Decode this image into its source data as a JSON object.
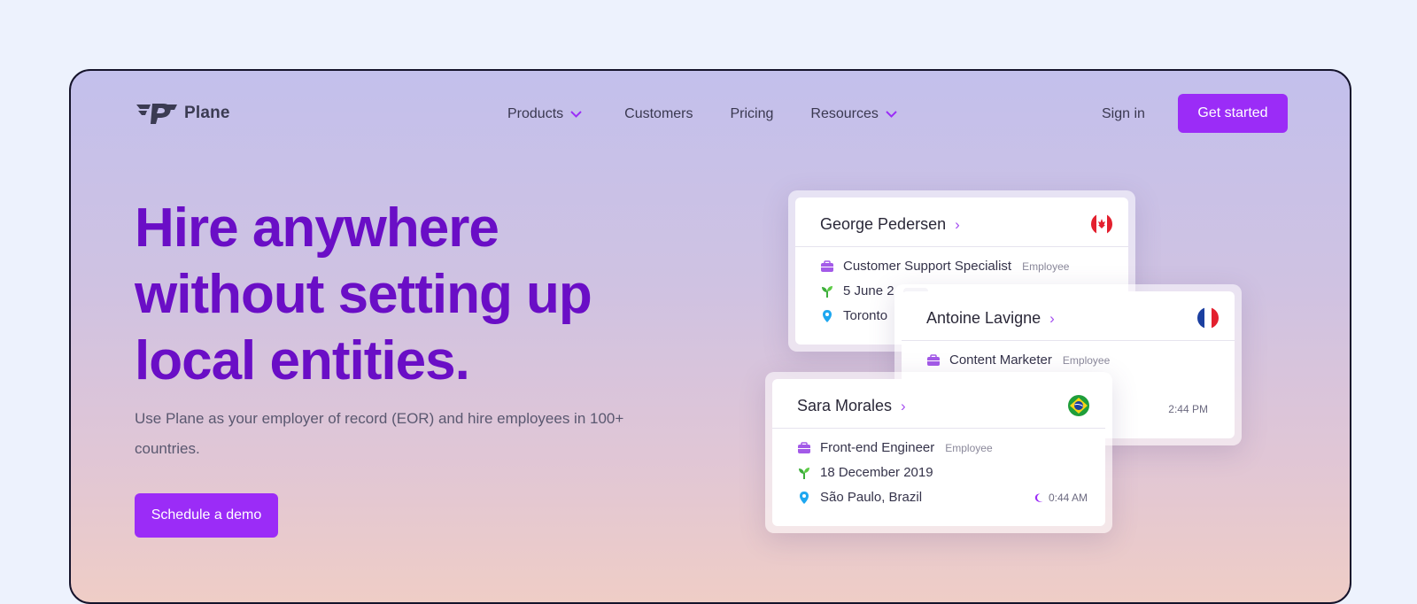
{
  "nav": {
    "logo_text": "Plane",
    "links": [
      {
        "label": "Products",
        "has_dropdown": true,
        "icon": "chevron-down-icon"
      },
      {
        "label": "Customers",
        "has_dropdown": false
      },
      {
        "label": "Pricing",
        "has_dropdown": false
      },
      {
        "label": "Resources",
        "has_dropdown": true,
        "icon": "chevron-down-icon"
      }
    ],
    "sign_in": "Sign in",
    "get_started": "Get started"
  },
  "hero": {
    "title": "Hire anywhere without setting up local entities.",
    "subtitle": "Use Plane as your employer of record (EOR) and hire employees in 100+ countries.",
    "cta": "Schedule a demo"
  },
  "cards": [
    {
      "name": "George Pedersen",
      "flag": "canada-flag",
      "role": "Customer Support Specialist",
      "employment": "Employee",
      "start_date": "5 June 2",
      "location": "Toronto"
    },
    {
      "name": "Antoine Lavigne",
      "flag": "france-flag",
      "role": "Content Marketer",
      "employment": "Employee",
      "time": "2:44 PM"
    },
    {
      "name": "Sara Morales",
      "flag": "brazil-flag",
      "role": "Front-end Engineer",
      "employment": "Employee",
      "start_date": "18 December 2019",
      "location": "São Paulo, Brazil",
      "time": "0:44 AM",
      "time_icon": "moon-icon"
    }
  ],
  "colors": {
    "accent": "#9b2cf7",
    "title": "#6a0ec6",
    "page_bg": "#edf2fd",
    "frame_border": "#15132b"
  }
}
